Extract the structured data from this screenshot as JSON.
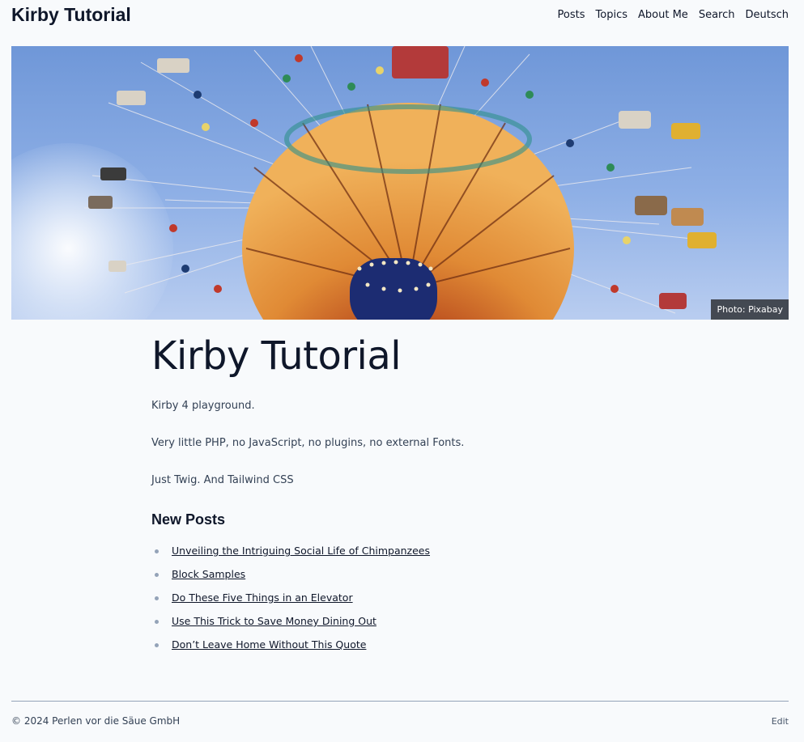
{
  "header": {
    "site_title": "Kirby Tutorial",
    "nav": [
      {
        "label": "Posts"
      },
      {
        "label": "Topics"
      },
      {
        "label": "About Me"
      },
      {
        "label": "Search"
      },
      {
        "label": "Deutsch"
      }
    ]
  },
  "hero": {
    "credit": "Photo: Pixabay"
  },
  "main": {
    "title": "Kirby Tutorial",
    "paragraphs": [
      "Kirby 4 playground.",
      "Very little PHP, no JavaScript, no plugins, no external Fonts.",
      "Just Twig. And Tailwind CSS"
    ],
    "new_posts_heading": "New Posts",
    "posts": [
      {
        "title": "Unveiling the Intriguing Social Life of Chimpanzees"
      },
      {
        "title": "Block Samples"
      },
      {
        "title": "Do These Five Things in an Elevator"
      },
      {
        "title": "Use This Trick to Save Money Dining Out"
      },
      {
        "title": "Don’t Leave Home Without This Quote"
      }
    ]
  },
  "footer": {
    "copyright": "© 2024 Perlen vor die Säue GmbH",
    "edit_label": "Edit"
  },
  "colors": {
    "background": "#f8fafc",
    "text": "#0f172a",
    "sky": "#8fb0e6",
    "carousel_orange": "#d9772a"
  }
}
